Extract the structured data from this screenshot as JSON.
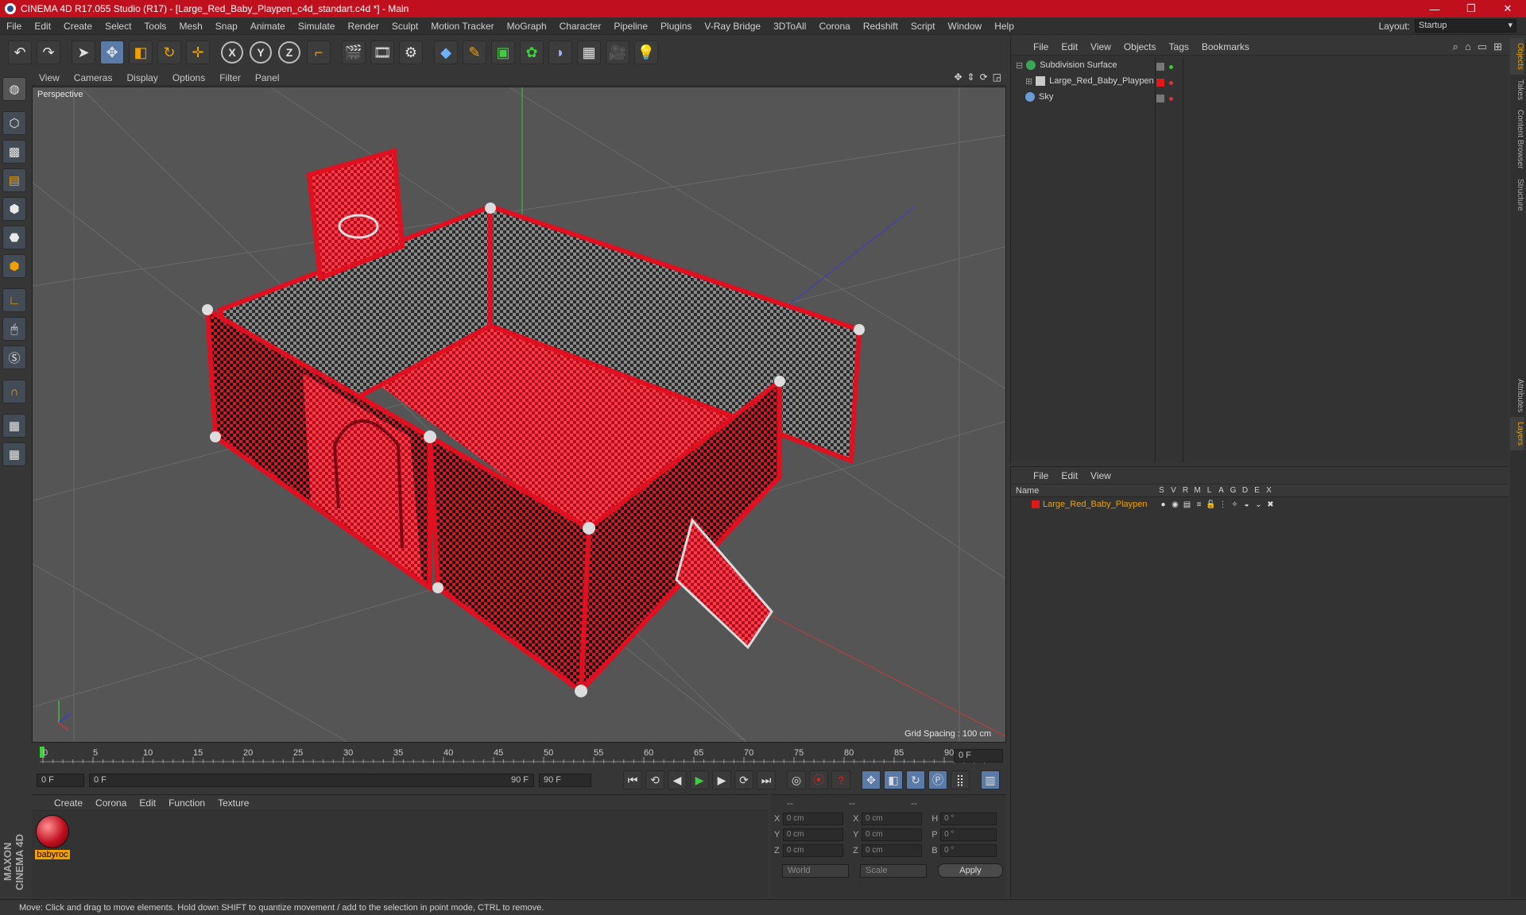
{
  "window": {
    "title": "CINEMA 4D R17.055 Studio (R17) - [Large_Red_Baby_Playpen_c4d_standart.c4d *] - Main",
    "controls": [
      "—",
      "❐",
      "✕"
    ]
  },
  "menu": [
    "File",
    "Edit",
    "Create",
    "Select",
    "Tools",
    "Mesh",
    "Snap",
    "Animate",
    "Simulate",
    "Render",
    "Sculpt",
    "Motion Tracker",
    "MoGraph",
    "Character",
    "Pipeline",
    "Plugins",
    "V-Ray Bridge",
    "3DToAll",
    "Corona",
    "Redshift",
    "Script",
    "Window",
    "Help"
  ],
  "layout": {
    "label": "Layout:",
    "value": "Startup"
  },
  "viewport": {
    "menu": [
      "View",
      "Cameras",
      "Display",
      "Options",
      "Filter",
      "Panel"
    ],
    "label": "Perspective",
    "grid_spacing": "Grid Spacing : 100 cm"
  },
  "timeline": {
    "ticks": [
      "0",
      "5",
      "10",
      "15",
      "20",
      "25",
      "30",
      "35",
      "40",
      "45",
      "50",
      "55",
      "60",
      "65",
      "70",
      "75",
      "80",
      "85",
      "90"
    ],
    "current_frame": "0 F",
    "start_field": "0 F",
    "range_start": "0 F",
    "range_end": "90 F",
    "end_field": "90 F"
  },
  "material_manager": {
    "menu": [
      "Create",
      "Corona",
      "Edit",
      "Function",
      "Texture"
    ],
    "materials": [
      {
        "name": "babyroc"
      }
    ]
  },
  "coordinates": {
    "header": [
      "--",
      "--",
      "--"
    ],
    "rows": [
      {
        "a": "X",
        "v1": "0 cm",
        "b": "X",
        "v2": "0 cm",
        "c": "H",
        "v3": "0 °"
      },
      {
        "a": "Y",
        "v1": "0 cm",
        "b": "Y",
        "v2": "0 cm",
        "c": "P",
        "v3": "0 °"
      },
      {
        "a": "Z",
        "v1": "0 cm",
        "b": "Z",
        "v2": "0 cm",
        "c": "B",
        "v3": "0 °"
      }
    ],
    "mode1": "World",
    "mode2": "Scale",
    "apply": "Apply"
  },
  "object_manager": {
    "menu": [
      "File",
      "Edit",
      "View",
      "Objects",
      "Tags",
      "Bookmarks"
    ],
    "objects": [
      {
        "name": "Subdivision Surface",
        "color": "#3aa65a"
      },
      {
        "name": "Large_Red_Baby_Playpen",
        "color": "#c9c9c9"
      },
      {
        "name": "Sky",
        "color": "#6a9ad8"
      }
    ]
  },
  "layer_manager": {
    "menu": [
      "File",
      "Edit",
      "View"
    ],
    "name_header": "Name",
    "columns": [
      "S",
      "V",
      "R",
      "M",
      "L",
      "A",
      "G",
      "D",
      "E",
      "X"
    ],
    "layers": [
      {
        "name": "Large_Red_Baby_Playpen",
        "color": "#e01818"
      }
    ]
  },
  "right_tabs": [
    "Objects",
    "Takes",
    "Content Browser",
    "Structure",
    "Attributes",
    "Layers"
  ],
  "status": "Move: Click and drag to move elements. Hold down SHIFT to quantize movement / add to the selection in point mode, CTRL to remove.",
  "branding": "MAXON CINEMA 4D",
  "colors": {
    "titlebar": "#c0101e",
    "accent": "#f0a000",
    "playpen": "#d41e2e"
  }
}
